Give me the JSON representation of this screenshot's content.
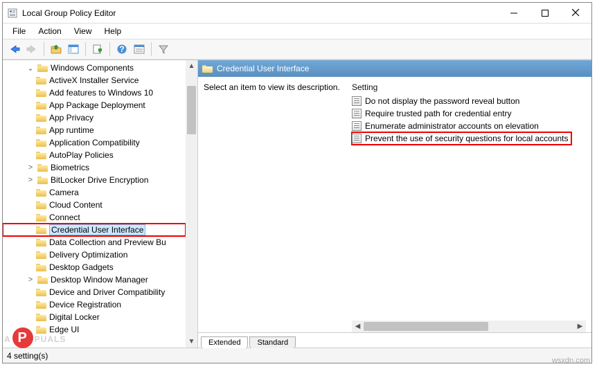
{
  "window": {
    "title": "Local Group Policy Editor"
  },
  "menu": {
    "file": "File",
    "action": "Action",
    "view": "View",
    "help": "Help"
  },
  "tree": {
    "top": "Windows Components",
    "items": [
      {
        "label": "ActiveX Installer Service"
      },
      {
        "label": "Add features to Windows 10"
      },
      {
        "label": "App Package Deployment"
      },
      {
        "label": "App Privacy"
      },
      {
        "label": "App runtime"
      },
      {
        "label": "Application Compatibility"
      },
      {
        "label": "AutoPlay Policies"
      },
      {
        "label": "Biometrics",
        "expandable": true
      },
      {
        "label": "BitLocker Drive Encryption",
        "expandable": true
      },
      {
        "label": "Camera"
      },
      {
        "label": "Cloud Content"
      },
      {
        "label": "Connect"
      },
      {
        "label": "Credential User Interface",
        "selected": true,
        "highlighted": true
      },
      {
        "label": "Data Collection and Preview Bu"
      },
      {
        "label": "Delivery Optimization"
      },
      {
        "label": "Desktop Gadgets"
      },
      {
        "label": "Desktop Window Manager",
        "expandable": true
      },
      {
        "label": "Device and Driver Compatibility"
      },
      {
        "label": "Device Registration"
      },
      {
        "label": "Digital Locker"
      },
      {
        "label": "Edge UI"
      }
    ]
  },
  "details": {
    "header": "Credential User Interface",
    "description_prompt": "Select an item to view its description.",
    "setting_header": "Setting",
    "settings": [
      {
        "name": "Do not display the password reveal button"
      },
      {
        "name": "Require trusted path for credential entry"
      },
      {
        "name": "Enumerate administrator accounts on elevation"
      },
      {
        "name": "Prevent the use of security questions for local accounts",
        "highlighted": true
      }
    ]
  },
  "tabs": {
    "extended": "Extended",
    "standard": "Standard"
  },
  "status": {
    "text": "4 setting(s)"
  },
  "watermark": {
    "brand_pre": "A",
    "brand_mid": "P",
    "brand_post": "PUALS",
    "site": "wsxdn.com"
  }
}
